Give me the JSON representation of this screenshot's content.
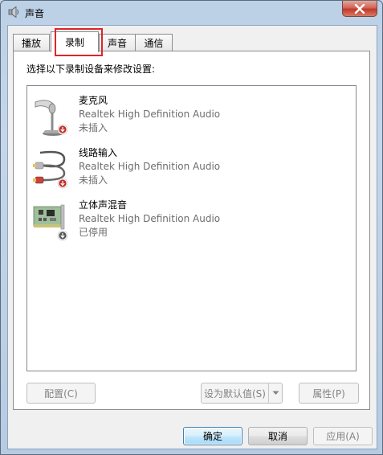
{
  "window": {
    "title": "声音",
    "icon": "speaker-icon"
  },
  "tabs": [
    {
      "label": "播放",
      "active": false
    },
    {
      "label": "录制",
      "active": true
    },
    {
      "label": "声音",
      "active": false
    },
    {
      "label": "通信",
      "active": false
    }
  ],
  "panel": {
    "instruction": "选择以下录制设备来修改设置:"
  },
  "devices": [
    {
      "name": "麦克风",
      "description": "Realtek High Definition Audio",
      "status": "未插入",
      "icon": "microphone-icon",
      "badge": "not-plugged-in-icon"
    },
    {
      "name": "线路输入",
      "description": "Realtek High Definition Audio",
      "status": "未插入",
      "icon": "line-in-cable-icon",
      "badge": "not-plugged-in-icon"
    },
    {
      "name": "立体声混音",
      "description": "Realtek High Definition Audio",
      "status": "已停用",
      "icon": "sound-card-icon",
      "badge": "disabled-icon"
    }
  ],
  "buttons": {
    "configure": "配置(C)",
    "set_default": "设为默认值(S)",
    "properties": "属性(P)",
    "ok": "确定",
    "cancel": "取消",
    "apply": "应用(A)"
  },
  "colors": {
    "highlight_border": "#e0242a",
    "badge_red": "#c0302a",
    "badge_gray": "#555555"
  }
}
